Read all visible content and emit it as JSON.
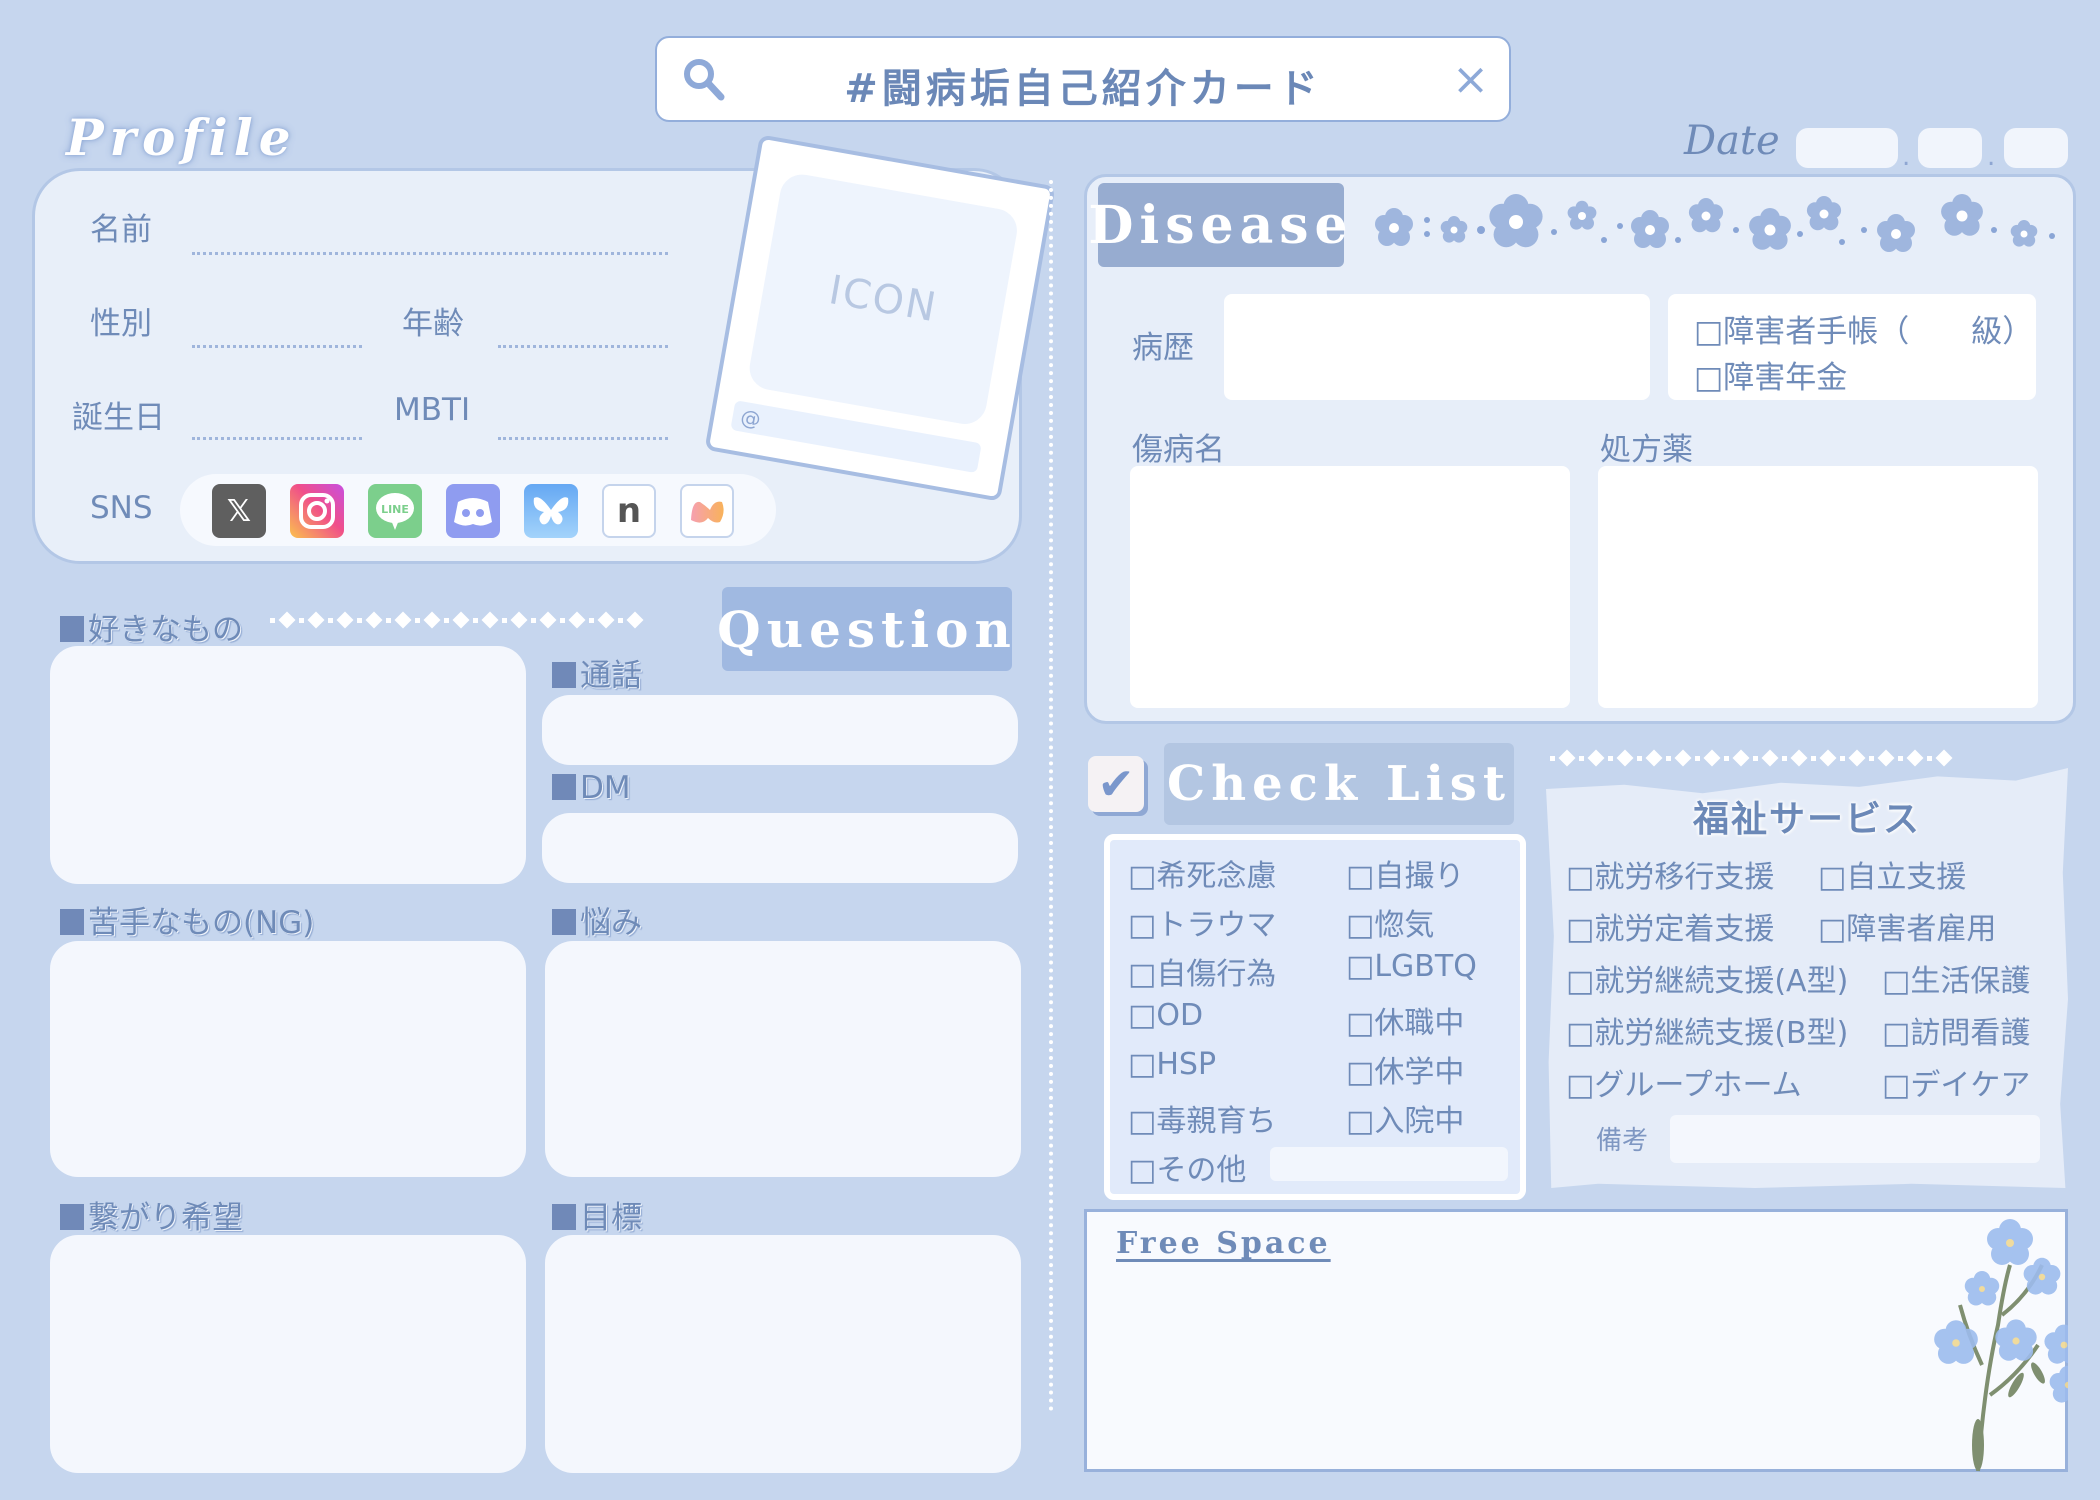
{
  "header": {
    "search_icon": "search-icon",
    "title": "#闘病垢自己紹介カード",
    "close_icon": "close-icon",
    "close_glyph": "×"
  },
  "profile": {
    "heading": "Profile",
    "fields": {
      "name": "名前",
      "gender": "性別",
      "age": "年齢",
      "birthday": "誕生日",
      "mbti": "MBTI",
      "sns": "SNS"
    },
    "sns_icons": [
      {
        "name": "x-icon",
        "glyph": "𝕏",
        "color": "#5f5f5f"
      },
      {
        "name": "instagram-icon",
        "glyph": "◎",
        "color": "#f0508c"
      },
      {
        "name": "line-icon",
        "glyph": "LINE",
        "color": "#7ccf8c"
      },
      {
        "name": "discord-icon",
        "glyph": "●●",
        "color": "#8f9cf0"
      },
      {
        "name": "bluesky-icon",
        "glyph": "🦋",
        "color": "#6fb3f5"
      },
      {
        "name": "note-icon",
        "glyph": "n",
        "color": "#ffffff"
      },
      {
        "name": "misskey-icon",
        "glyph": "M",
        "color": "#ffffff"
      }
    ],
    "icon_card": {
      "photo_label": "ICON",
      "handle_prefix": "@"
    }
  },
  "left_sections": {
    "likes": "好きなもの",
    "question_tab": "Question",
    "call": "通話",
    "dm": "DM",
    "dislikes": "苦手なもの(NG)",
    "worries": "悩み",
    "connect_wish": "繋がり希望",
    "goal": "目標"
  },
  "date": {
    "label": "Date",
    "separator": "."
  },
  "disease": {
    "heading": "Disease",
    "history_label": "病歴",
    "certificates": [
      "□障害者手帳（　　級）",
      "□障害年金"
    ],
    "diagnosis_label": "傷病名",
    "prescription_label": "処方薬"
  },
  "checklist": {
    "check_glyph": "✔",
    "heading": "Check List",
    "left_items": [
      "□希死念慮",
      "□トラウマ",
      "□自傷行為",
      "□OD",
      "□HSP",
      "□毒親育ち",
      "□その他"
    ],
    "right_items": [
      "□自撮り",
      "□惚気",
      "□LGBTQ",
      "□休職中",
      "□休学中",
      "□入院中"
    ]
  },
  "welfare": {
    "heading": "福祉サービス",
    "left_items": [
      "□就労移行支援",
      "□就労定着支援",
      "□就労継続支援(A型)",
      "□就労継続支援(B型)",
      "□グループホーム"
    ],
    "right_items": [
      "□自立支援",
      "□障害者雇用",
      "□生活保護",
      "□訪問看護",
      "□デイケア"
    ],
    "note_label": "備考"
  },
  "free_space": {
    "heading": "Free Space"
  },
  "colors": {
    "background": "#c6d6ee",
    "accent_text": "#6f8bb8",
    "card": "#e8eff9",
    "tab_dark": "#97acd0",
    "tab_light": "#a0b9e1"
  }
}
